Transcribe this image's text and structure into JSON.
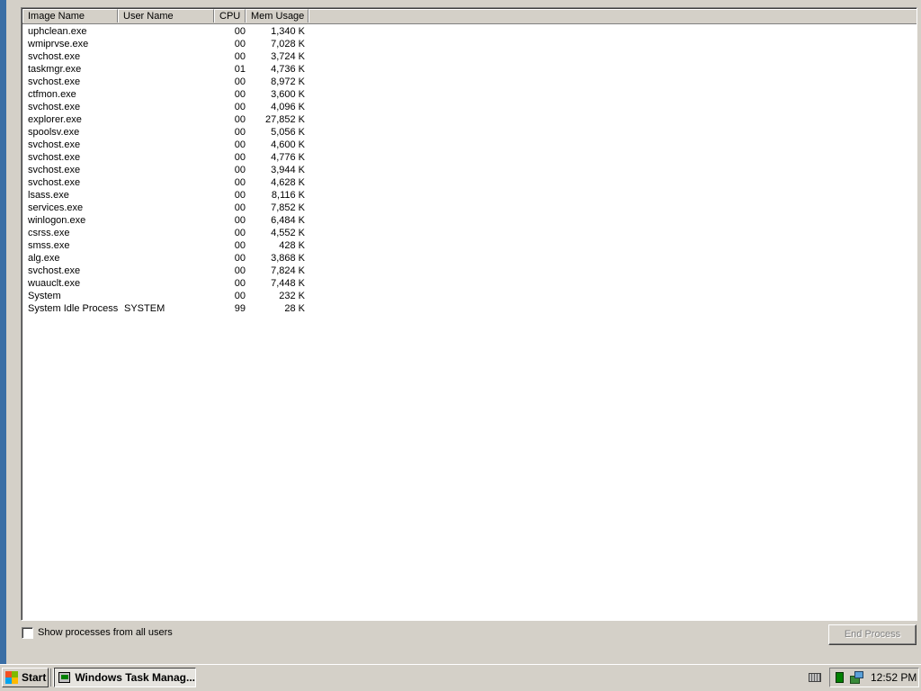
{
  "columns": {
    "image_name": "Image Name",
    "user_name": "User Name",
    "cpu": "CPU",
    "mem_usage": "Mem Usage"
  },
  "processes": [
    {
      "name": "uphclean.exe",
      "user": "",
      "cpu": "00",
      "mem": "1,340 K"
    },
    {
      "name": "wmiprvse.exe",
      "user": "",
      "cpu": "00",
      "mem": "7,028 K"
    },
    {
      "name": "svchost.exe",
      "user": "",
      "cpu": "00",
      "mem": "3,724 K"
    },
    {
      "name": "taskmgr.exe",
      "user": "",
      "cpu": "01",
      "mem": "4,736 K"
    },
    {
      "name": "svchost.exe",
      "user": "",
      "cpu": "00",
      "mem": "8,972 K"
    },
    {
      "name": "ctfmon.exe",
      "user": "",
      "cpu": "00",
      "mem": "3,600 K"
    },
    {
      "name": "svchost.exe",
      "user": "",
      "cpu": "00",
      "mem": "4,096 K"
    },
    {
      "name": "explorer.exe",
      "user": "",
      "cpu": "00",
      "mem": "27,852 K"
    },
    {
      "name": "spoolsv.exe",
      "user": "",
      "cpu": "00",
      "mem": "5,056 K"
    },
    {
      "name": "svchost.exe",
      "user": "",
      "cpu": "00",
      "mem": "4,600 K"
    },
    {
      "name": "svchost.exe",
      "user": "",
      "cpu": "00",
      "mem": "4,776 K"
    },
    {
      "name": "svchost.exe",
      "user": "",
      "cpu": "00",
      "mem": "3,944 K"
    },
    {
      "name": "svchost.exe",
      "user": "",
      "cpu": "00",
      "mem": "4,628 K"
    },
    {
      "name": "lsass.exe",
      "user": "",
      "cpu": "00",
      "mem": "8,116 K"
    },
    {
      "name": "services.exe",
      "user": "",
      "cpu": "00",
      "mem": "7,852 K"
    },
    {
      "name": "winlogon.exe",
      "user": "",
      "cpu": "00",
      "mem": "6,484 K"
    },
    {
      "name": "csrss.exe",
      "user": "",
      "cpu": "00",
      "mem": "4,552 K"
    },
    {
      "name": "smss.exe",
      "user": "",
      "cpu": "00",
      "mem": "428 K"
    },
    {
      "name": "alg.exe",
      "user": "",
      "cpu": "00",
      "mem": "3,868 K"
    },
    {
      "name": "svchost.exe",
      "user": "",
      "cpu": "00",
      "mem": "7,824 K"
    },
    {
      "name": "wuauclt.exe",
      "user": "",
      "cpu": "00",
      "mem": "7,448 K"
    },
    {
      "name": "System",
      "user": "",
      "cpu": "00",
      "mem": "232 K"
    },
    {
      "name": "System Idle Process",
      "user": "SYSTEM",
      "cpu": "99",
      "mem": "28 K"
    }
  ],
  "footer": {
    "show_all_label": "Show processes from all users",
    "show_all_checked": false,
    "end_process_label": "End Process"
  },
  "taskbar": {
    "start_label": "Start",
    "task_label": "Windows Task Manag...",
    "clock": "12:52 PM"
  },
  "icons": {
    "start": "windows-logo-icon",
    "task": "task-manager-icon",
    "keyboard": "keyboard-icon",
    "tray_1": "task-manager-cpu-icon",
    "tray_2": "network-icon"
  }
}
